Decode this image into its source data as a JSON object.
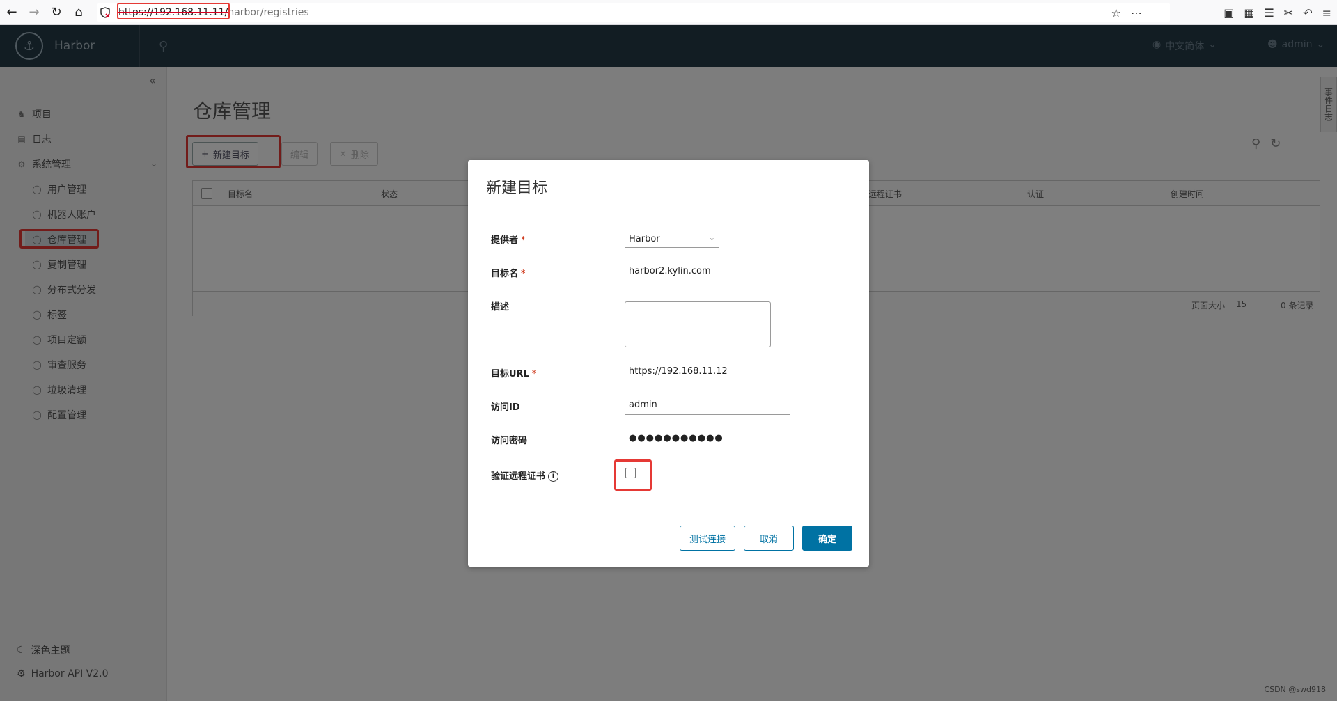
{
  "browser": {
    "url_host": "https://192.168.11.11/",
    "url_path": "harbor/registries"
  },
  "header": {
    "brand": "Harbor",
    "language": "中文简体",
    "user": "admin"
  },
  "sidebar": {
    "items": [
      {
        "label": "项目"
      },
      {
        "label": "日志"
      },
      {
        "label": "系统管理"
      }
    ],
    "sub_items": [
      {
        "label": "用户管理"
      },
      {
        "label": "机器人账户"
      },
      {
        "label": "仓库管理"
      },
      {
        "label": "复制管理"
      },
      {
        "label": "分布式分发"
      },
      {
        "label": "标签"
      },
      {
        "label": "项目定额"
      },
      {
        "label": "审查服务"
      },
      {
        "label": "垃圾清理"
      },
      {
        "label": "配置管理"
      }
    ],
    "bottom": [
      {
        "label": "深色主题"
      },
      {
        "label": "Harbor API V2.0"
      }
    ]
  },
  "main": {
    "title": "仓库管理",
    "actions": {
      "new": "新建目标",
      "edit": "编辑",
      "delete": "删除"
    },
    "columns": [
      "目标名",
      "状态",
      "远程证书",
      "认证",
      "创建时间"
    ],
    "footer": {
      "page_size_label": "页面大小",
      "page_size": "15",
      "count": "0 条记录"
    },
    "side_tab": "事件日志"
  },
  "modal": {
    "title": "新建目标",
    "provider_label": "提供者",
    "provider_value": "Harbor",
    "name_label": "目标名",
    "name_value": "harbor2.kylin.com",
    "desc_label": "描述",
    "url_label": "目标URL",
    "url_value": "https://192.168.11.12",
    "access_id_label": "访问ID",
    "access_id_value": "admin",
    "access_secret_label": "访问密码",
    "access_secret_value": "●●●●●●●●●●●",
    "verify_label": "验证远程证书",
    "verify_checked": false,
    "test_button": "测试连接",
    "cancel_button": "取消",
    "ok_button": "确定"
  },
  "watermark": "CSDN @swd918",
  "colors": {
    "header_bg": "#253a46",
    "primary": "#0072a3",
    "highlight": "#e53935"
  }
}
